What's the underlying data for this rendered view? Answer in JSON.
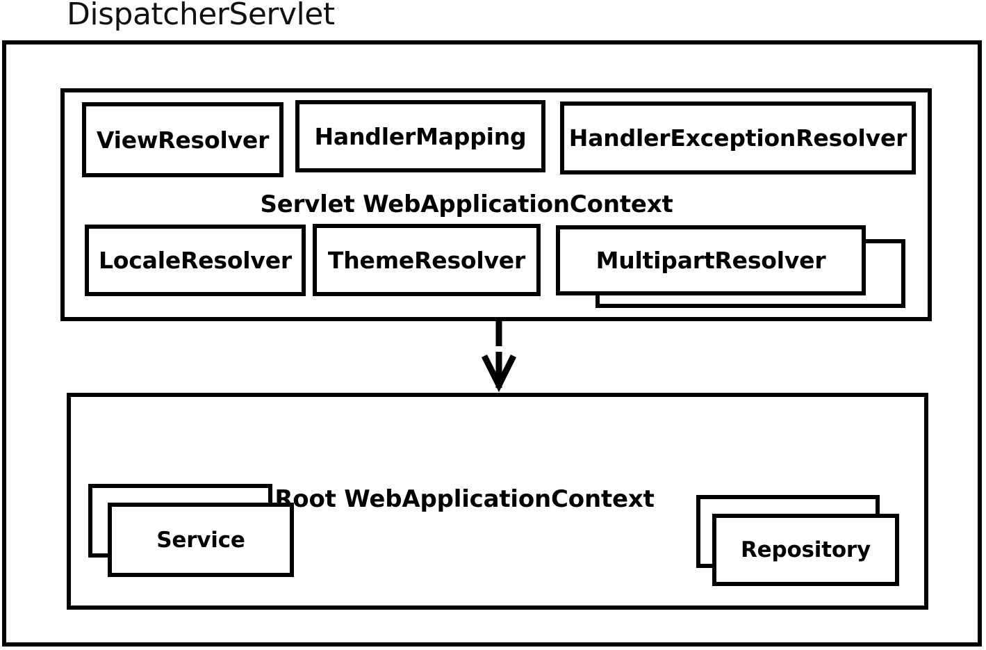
{
  "diagram": {
    "title": "DispatcherServlet",
    "type": "architecture-block-diagram"
  },
  "outer_container": {
    "name": "DispatcherServlet",
    "label": "DispatcherServlet"
  },
  "servlet_context": {
    "label": "Servlet WebApplicationContext",
    "components_row1": [
      {
        "label": "ViewResolver",
        "stacked": false
      },
      {
        "label": "HandlerMapping",
        "stacked": false
      },
      {
        "label": "HandlerExceptionResolver",
        "stacked": false
      }
    ],
    "components_row2": [
      {
        "label": "LocaleResolver",
        "stacked": false
      },
      {
        "label": "ThemeResolver",
        "stacked": false
      },
      {
        "label": "MultipartResolver",
        "stacked": true
      }
    ]
  },
  "root_context": {
    "label": "Root WebApplicationContext",
    "components": [
      {
        "label": "Service",
        "stacked": true
      },
      {
        "label": "Repository",
        "stacked": true
      }
    ]
  },
  "connector": {
    "name": "inheritance-arrow",
    "from": "Servlet WebApplicationContext",
    "to": "Root WebApplicationContext",
    "direction": "down",
    "style": "solid-line-open-arrowhead"
  },
  "colors": {
    "stroke": "#000000",
    "fill": "#ffffff",
    "text": "#000000"
  }
}
